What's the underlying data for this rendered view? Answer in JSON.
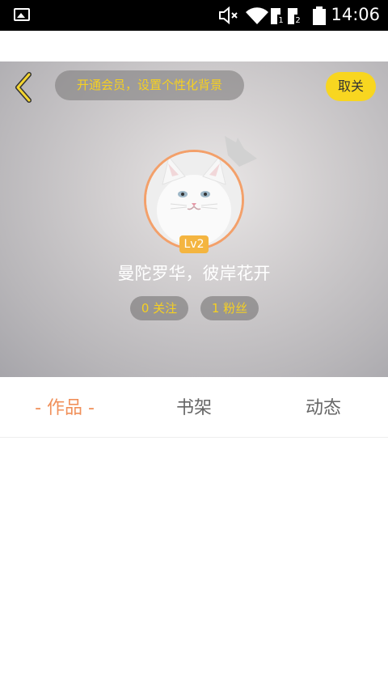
{
  "status_bar": {
    "time": "14:06",
    "icons": [
      "gallery-icon",
      "mute-icon",
      "wifi-icon",
      "sim1-icon",
      "sim2-icon",
      "battery-icon"
    ]
  },
  "header": {
    "back_icon": "back-arrow-icon",
    "vip_banner": "开通会员，设置个性化背景",
    "unfollow_label": "取关"
  },
  "profile": {
    "avatar_icon": "cat-avatar",
    "crown_icon": "crown-icon",
    "level": "Lv2",
    "username": "曼陀罗华，彼岸花开",
    "follow_stat": "0 关注",
    "fans_stat": "1 粉丝"
  },
  "tabs": [
    {
      "label": "- 作品 -",
      "active": true
    },
    {
      "label": "书架",
      "active": false
    },
    {
      "label": "动态",
      "active": false
    }
  ],
  "colors": {
    "accent_yellow": "#f8d620",
    "accent_orange": "#f0905a",
    "level_badge": "#f4b540"
  }
}
